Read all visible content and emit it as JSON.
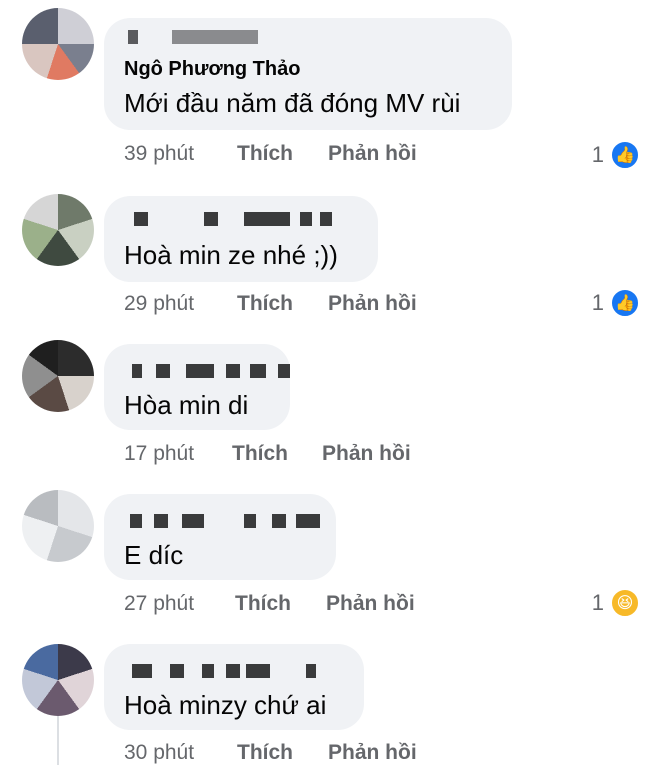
{
  "comments": [
    {
      "name": "Ngô Phương Thảo",
      "text": "Mới đầu năm đã đóng MV rùi",
      "time": "39 phút",
      "like": "Thích",
      "reply": "Phản hồi",
      "reaction_count": "1",
      "reaction_icon": "like-icon"
    },
    {
      "name": "",
      "text": "Hoà min ze nhé ;))",
      "time": "29 phút",
      "like": "Thích",
      "reply": "Phản hồi",
      "reaction_count": "1",
      "reaction_icon": "like-icon"
    },
    {
      "name": "",
      "text": "Hòa min di",
      "time": "17 phút",
      "like": "Thích",
      "reply": "Phản hồi",
      "reaction_count": "",
      "reaction_icon": ""
    },
    {
      "name": "",
      "text": "E díc",
      "time": "27 phút",
      "like": "Thích",
      "reply": "Phản hồi",
      "reaction_count": "1",
      "reaction_icon": "haha-icon"
    },
    {
      "name": "",
      "text": "Hoà minzy chứ ai",
      "time": "30 phút",
      "like": "Thích",
      "reply": "Phản hồi",
      "reaction_count": "",
      "reaction_icon": ""
    }
  ],
  "icons": {
    "like_symbol": "👍",
    "haha_symbol": "😆"
  },
  "colors": {
    "bubble": "#f0f2f5",
    "meta_text": "#65676b",
    "like_blue": "#1877f2",
    "haha_yellow": "#f7b928"
  }
}
